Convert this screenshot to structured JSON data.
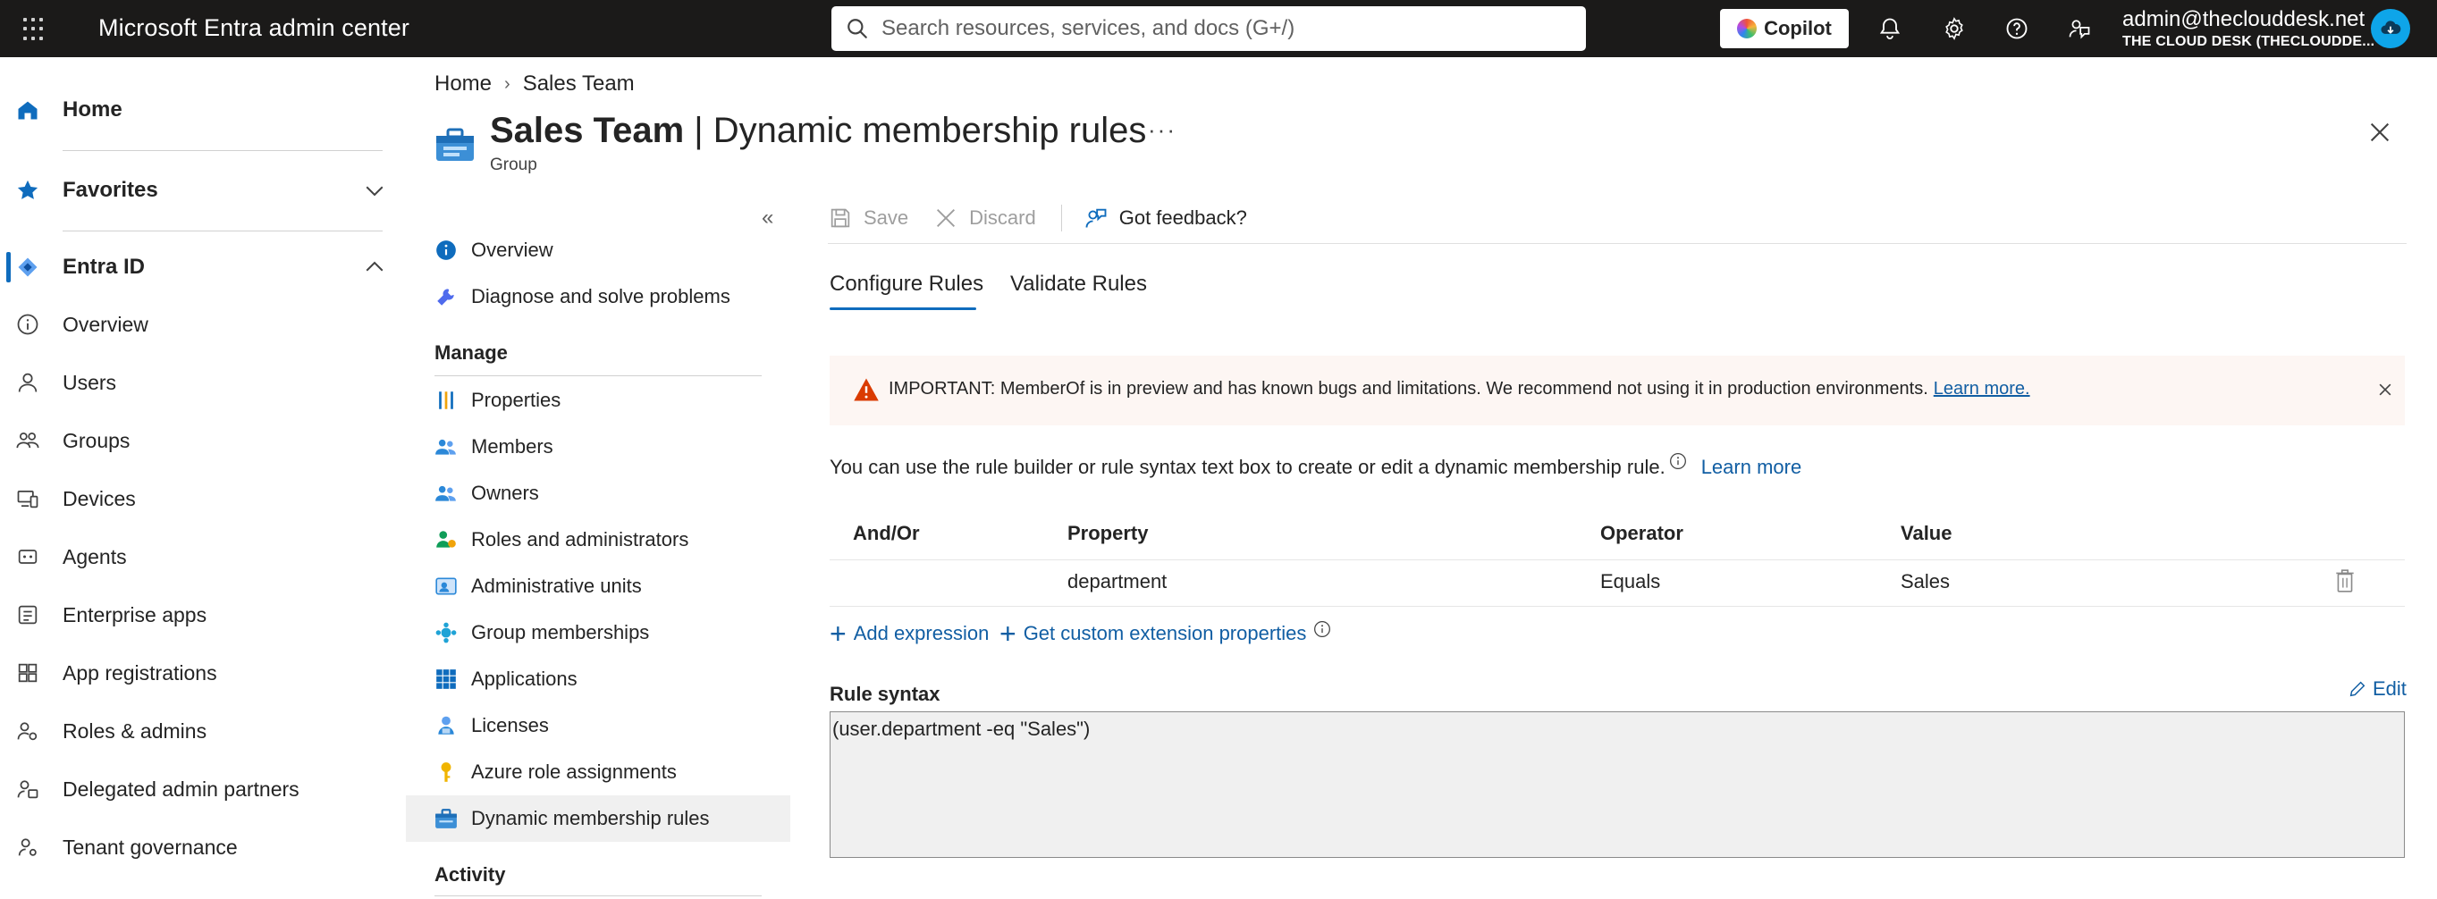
{
  "topbar": {
    "brand": "Microsoft Entra admin center",
    "search_placeholder": "Search resources, services, and docs (G+/)",
    "copilot_label": "Copilot",
    "account_email": "admin@theclouddesk.net",
    "account_tenant": "THE CLOUD DESK (THECLOUDDE..."
  },
  "leftnav": {
    "home": "Home",
    "favorites": "Favorites",
    "entra_id": "Entra ID",
    "items": [
      {
        "label": "Overview",
        "icon": "info-circle-icon"
      },
      {
        "label": "Users",
        "icon": "person-icon"
      },
      {
        "label": "Groups",
        "icon": "people-icon"
      },
      {
        "label": "Devices",
        "icon": "devices-icon"
      },
      {
        "label": "Agents",
        "icon": "agent-icon"
      },
      {
        "label": "Enterprise apps",
        "icon": "enterprise-apps-icon"
      },
      {
        "label": "App registrations",
        "icon": "app-registrations-icon"
      },
      {
        "label": "Roles & admins",
        "icon": "roles-icon"
      },
      {
        "label": "Delegated admin partners",
        "icon": "delegated-partners-icon"
      },
      {
        "label": "Tenant governance",
        "icon": "governance-icon"
      }
    ]
  },
  "breadcrumb": {
    "home": "Home",
    "current": "Sales Team"
  },
  "header": {
    "title_bold": "Sales Team",
    "title_rest": " | Dynamic membership rules",
    "subtitle": "Group",
    "more": "···"
  },
  "resource_menu": {
    "collapse": "«",
    "top_items": [
      {
        "label": "Overview"
      },
      {
        "label": "Diagnose and solve problems"
      }
    ],
    "manage_header": "Manage",
    "manage_items": [
      {
        "label": "Properties"
      },
      {
        "label": "Members"
      },
      {
        "label": "Owners"
      },
      {
        "label": "Roles and administrators"
      },
      {
        "label": "Administrative units"
      },
      {
        "label": "Group memberships"
      },
      {
        "label": "Applications"
      },
      {
        "label": "Licenses"
      },
      {
        "label": "Azure role assignments"
      },
      {
        "label": "Dynamic membership rules"
      }
    ],
    "activity_header": "Activity"
  },
  "toolbar": {
    "save": "Save",
    "discard": "Discard",
    "feedback": "Got feedback?"
  },
  "tabs": {
    "configure": "Configure Rules",
    "validate": "Validate Rules"
  },
  "warning": {
    "text": "IMPORTANT: MemberOf is in preview and has known bugs and limitations. We recommend not using it in production environments.",
    "link": "Learn more."
  },
  "info": {
    "text": "You can use the rule builder or rule syntax text box to create or edit a dynamic membership rule.",
    "link": "Learn more"
  },
  "rule_table": {
    "headers": {
      "andor": "And/Or",
      "property": "Property",
      "operator": "Operator",
      "value": "Value"
    },
    "rows": [
      {
        "andor": "",
        "property": "department",
        "operator": "Equals",
        "value": "Sales"
      }
    ]
  },
  "actions": {
    "add_expression": "Add expression",
    "custom_ext": "Get custom extension properties"
  },
  "rule_syntax": {
    "label": "Rule syntax",
    "edit": "Edit",
    "value": "(user.department -eq \"Sales\")"
  },
  "colors": {
    "accent": "#0f6cbd",
    "link": "#115ea3",
    "topbar": "#1b1a19",
    "warning_bg": "#fdf6f3",
    "warning_icon": "#da3b01"
  }
}
